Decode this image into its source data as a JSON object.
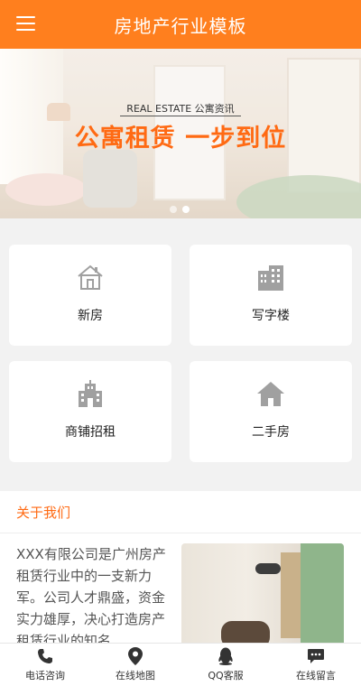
{
  "header": {
    "title": "房地产行业模板",
    "menu_icon": "hamburger-menu-icon"
  },
  "banner": {
    "subtitle": "REAL ESTATE 公寓资讯",
    "headline": "公寓租赁 一步到位",
    "slides_total": 2,
    "active_slide": 2
  },
  "categories": [
    {
      "label": "新房",
      "icon": "house-icon"
    },
    {
      "label": "写字楼",
      "icon": "office-building-icon"
    },
    {
      "label": "商铺招租",
      "icon": "shop-building-icon"
    },
    {
      "label": "二手房",
      "icon": "home-icon"
    }
  ],
  "about": {
    "title": "关于我们",
    "text": "XXX有限公司是广州房产租赁行业中的一支新力军。公司人才鼎盛，资金实力雄厚，决心打造房产租赁行业的知名"
  },
  "tabbar": [
    {
      "label": "电话咨询",
      "icon": "phone-icon"
    },
    {
      "label": "在线地图",
      "icon": "map-pin-icon"
    },
    {
      "label": "QQ客服",
      "icon": "qq-icon"
    },
    {
      "label": "在线留言",
      "icon": "message-icon"
    }
  ],
  "colors": {
    "brand": "#ff7f1e",
    "accent": "#ff6a13",
    "icon_gray": "#a0a0a0"
  }
}
